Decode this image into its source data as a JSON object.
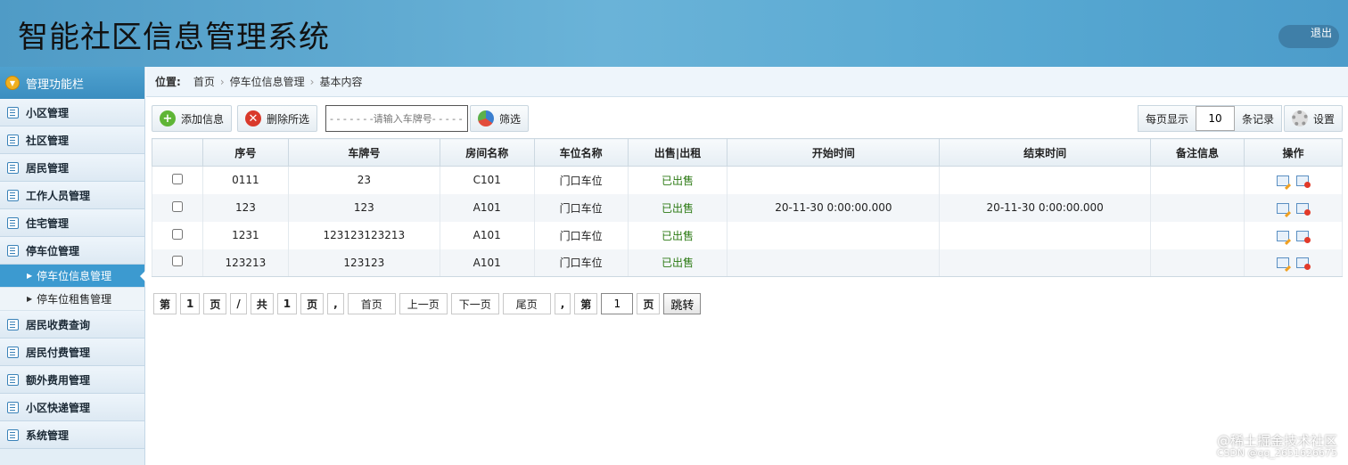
{
  "header": {
    "title": "智能社区信息管理系统",
    "logout": "退出"
  },
  "sidebar": {
    "head": "管理功能栏",
    "items": [
      {
        "label": "小区管理"
      },
      {
        "label": "社区管理"
      },
      {
        "label": "居民管理"
      },
      {
        "label": "工作人员管理"
      },
      {
        "label": "住宅管理"
      },
      {
        "label": "停车位管理"
      }
    ],
    "sub_items": [
      {
        "label": "停车位信息管理",
        "active": true
      },
      {
        "label": "停车位租售管理",
        "active": false
      }
    ],
    "items_after": [
      {
        "label": "居民收费查询"
      },
      {
        "label": "居民付费管理"
      },
      {
        "label": "额外费用管理"
      },
      {
        "label": "小区快递管理"
      },
      {
        "label": "系统管理"
      }
    ]
  },
  "breadcrumb": {
    "label": "位置:",
    "crumbs": [
      "首页",
      "停车位信息管理",
      "基本内容"
    ]
  },
  "toolbar": {
    "add": "添加信息",
    "delete": "删除所选",
    "plate_placeholder": "- - - - - - -请输入车牌号- - - - - - -",
    "filter": "筛选",
    "perpage_label": "每页显示",
    "perpage_value": "10",
    "perpage_unit": "条记录",
    "settings": "设置"
  },
  "table": {
    "columns": [
      "",
      "序号",
      "车牌号",
      "房间名称",
      "车位名称",
      "出售|出租",
      "开始时间",
      "结束时间",
      "备注信息",
      "操作"
    ],
    "rows": [
      [
        "0111",
        "23",
        "C101",
        "门口车位",
        "已出售",
        "",
        "",
        ""
      ],
      [
        "123",
        "123",
        "A101",
        "门口车位",
        "已出售",
        "20-11-30 0:00:00.000",
        "20-11-30 0:00:00.000",
        ""
      ],
      [
        "1231",
        "123123123213",
        "A101",
        "门口车位",
        "已出售",
        "",
        "",
        ""
      ],
      [
        "123213",
        "123123",
        "A101",
        "门口车位",
        "已出售",
        "",
        "",
        ""
      ]
    ]
  },
  "pager": {
    "di": "第",
    "current": "1",
    "ye": "页",
    "slash": "/",
    "gong": "共",
    "total": "1",
    "ye2": "页",
    "comma": ",",
    "first": "首页",
    "prev": "上一页",
    "next": "下一页",
    "last": "尾页",
    "comma2": ",",
    "di2": "第",
    "jump_value": "1",
    "ye3": "页",
    "jump": "跳转"
  },
  "watermark": {
    "line1": "@稀土掘金技术社区",
    "line2": "CSDN @qq_2651626675"
  },
  "colors": {
    "header": "#5aa8d4",
    "active": "#3c9ad0",
    "sold": "#2c7a14"
  }
}
